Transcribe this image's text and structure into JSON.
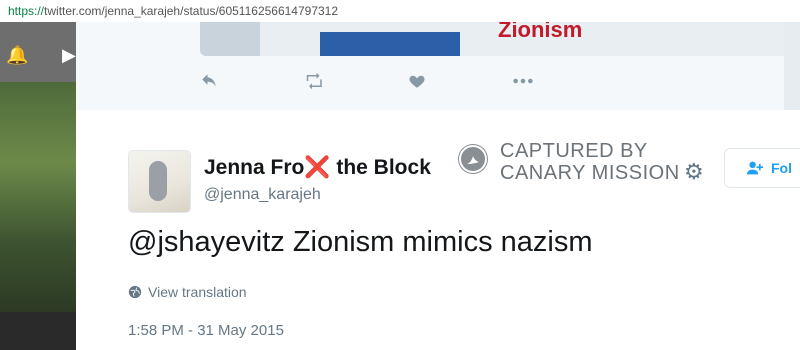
{
  "browser": {
    "url_scheme": "https://",
    "url_rest": "twitter.com/jenna_karajeh/status/605116256614797312"
  },
  "icons": {
    "bell": "bell-icon",
    "play": "play-icon",
    "reply": "reply-icon",
    "retweet": "retweet-icon",
    "like": "heart-icon",
    "more": "more-icon",
    "gear": "gear-icon",
    "follow": "follow-user-icon",
    "globe": "globe-icon",
    "canary": "canary-logo"
  },
  "previous_tweet": {
    "media_text": "Zionism"
  },
  "tweet": {
    "display_name_part1": "Jenna Fro",
    "display_name_emoji": "❌",
    "display_name_part2": " the Block",
    "handle": "@jenna_karajeh",
    "text": "@jshayevitz Zionism mimics nazism",
    "translation_label": "View translation",
    "timestamp": "1:58 PM - 31 May 2015",
    "follow_label": "Fol"
  },
  "watermark": {
    "line1": "CAPTURED BY",
    "line2": "CANARY MISSION"
  },
  "colors": {
    "accent": "#1da1f2",
    "muted": "#657786",
    "text": "#14171a",
    "error_x": "#e0245e"
  }
}
